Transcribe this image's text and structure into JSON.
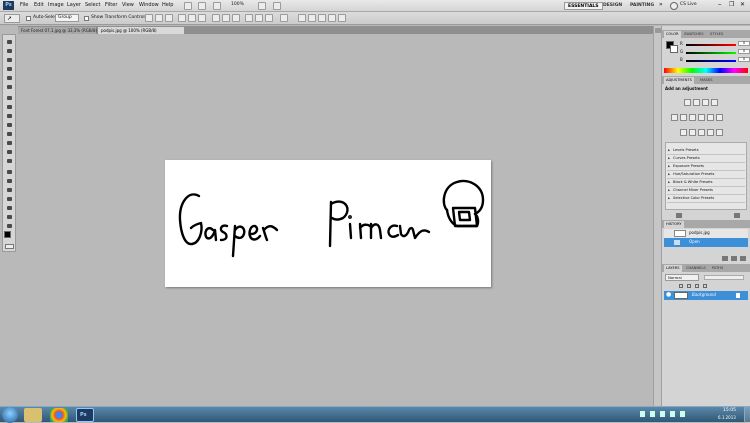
{
  "menubar": {
    "app_logo": "Ps",
    "items": [
      "File",
      "Edit",
      "Image",
      "Layer",
      "Select",
      "Filter",
      "View",
      "Window",
      "Help"
    ],
    "zoom": "100%",
    "workspaces": [
      "ESSENTIALS",
      "DESIGN",
      "PAINTING"
    ],
    "more": "»",
    "cs_live": "CS Live"
  },
  "options": {
    "auto_select_label": "Auto-Select:",
    "auto_select_value": "Group",
    "show_transform_label": "Show Transform Controls"
  },
  "tabs": [
    {
      "label": "Font Forest 07.1.jpg @ 33,3% (RGB/8)",
      "active": false
    },
    {
      "label": "podpis.jpg @ 100% (RGB/8)",
      "active": true
    }
  ],
  "color_panel": {
    "tabs": [
      "COLOR",
      "SWATCHES",
      "STYLES"
    ],
    "sliders": [
      {
        "label": "R",
        "value": "0",
        "color": "#d33"
      },
      {
        "label": "G",
        "value": "0",
        "color": "#3a3"
      },
      {
        "label": "B",
        "value": "0",
        "color": "#33d"
      }
    ]
  },
  "adjustments_panel": {
    "tabs": [
      "ADJUSTMENTS",
      "MASKS"
    ],
    "title": "Add an adjustment",
    "presets": [
      "Levels Presets",
      "Curves Presets",
      "Exposure Presets",
      "Hue/Saturation Presets",
      "Black & White Presets",
      "Channel Mixer Presets",
      "Selective Color Presets"
    ]
  },
  "history_panel": {
    "tabs": [
      "HISTORY"
    ],
    "items": [
      {
        "label": "podpis.jpg",
        "selected": false
      },
      {
        "label": "Open",
        "selected": true
      }
    ]
  },
  "layers_panel": {
    "tabs": [
      "LAYERS",
      "CHANNELS",
      "PATHS"
    ],
    "blend_mode": "Normal",
    "layers": [
      {
        "name": "Background",
        "selected": true
      }
    ]
  },
  "taskbar": {
    "time": "15:05",
    "date": "6.1.2013"
  },
  "colors": {
    "workspace_bg": "#b9b9b9",
    "selection": "#3d8fd8",
    "taskbar": "#3a6688"
  }
}
